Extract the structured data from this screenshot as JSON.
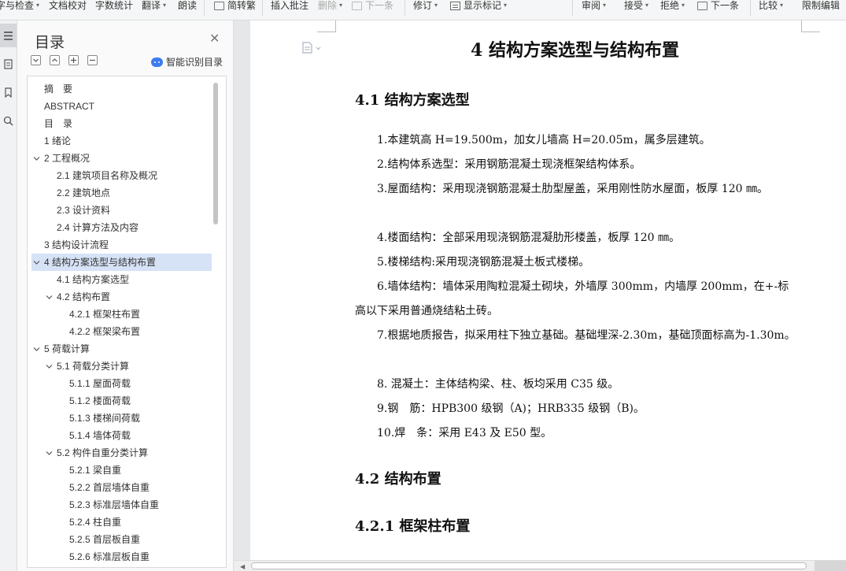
{
  "toolbar": {
    "items": [
      {
        "label": "字与检查",
        "caret": true
      },
      {
        "label": "文档校对",
        "caret": false
      },
      {
        "label": "字数统计",
        "caret": false
      },
      {
        "label": "翻译",
        "caret": true
      },
      {
        "label": "朗读",
        "caret": false
      },
      {
        "label": "简转繁",
        "caret": false
      },
      {
        "label": "插入批注",
        "caret": false
      },
      {
        "label": "删除",
        "caret": true
      },
      {
        "label": "下一条",
        "caret": false
      },
      {
        "label": "修订",
        "caret": true
      },
      {
        "label": "显示标记",
        "caret": true
      },
      {
        "label": "审阅",
        "caret": true
      },
      {
        "label": "接受",
        "caret": true
      },
      {
        "label": "拒绝",
        "caret": true
      },
      {
        "label": "下一条",
        "caret": false
      },
      {
        "label": "比较",
        "caret": true
      },
      {
        "label": "限制编辑",
        "caret": false
      }
    ],
    "caret_glyph": "▾"
  },
  "toc": {
    "title": "目录",
    "close_glyph": "✕",
    "smart_label": "智能识别目录",
    "expanded_glyph": "⌄",
    "items": [
      {
        "label": "摘　要",
        "level": 1,
        "caret": false,
        "selected": false
      },
      {
        "label": "ABSTRACT",
        "level": 1,
        "caret": false,
        "selected": false
      },
      {
        "label": "目　录",
        "level": 1,
        "caret": false,
        "selected": false
      },
      {
        "label": "1 绪论",
        "level": 1,
        "caret": false,
        "selected": false
      },
      {
        "label": "2 工程概况",
        "level": 1,
        "caret": true,
        "selected": false
      },
      {
        "label": "2.1 建筑项目名称及概况",
        "level": 2,
        "caret": false,
        "selected": false
      },
      {
        "label": "2.2 建筑地点",
        "level": 2,
        "caret": false,
        "selected": false
      },
      {
        "label": "2.3  设计资料",
        "level": 2,
        "caret": false,
        "selected": false
      },
      {
        "label": "2.4 计算方法及内容",
        "level": 2,
        "caret": false,
        "selected": false
      },
      {
        "label": "3 结构设计流程",
        "level": 1,
        "caret": false,
        "selected": false
      },
      {
        "label": "4 结构方案选型与结构布置",
        "level": 1,
        "caret": true,
        "selected": true
      },
      {
        "label": "4.1 结构方案选型",
        "level": 2,
        "caret": false,
        "selected": false
      },
      {
        "label": "4.2 结构布置",
        "level": 2,
        "caret": true,
        "selected": false
      },
      {
        "label": "4.2.1 框架柱布置",
        "level": 3,
        "caret": false,
        "selected": false
      },
      {
        "label": "4.2.2 框架梁布置",
        "level": 3,
        "caret": false,
        "selected": false
      },
      {
        "label": "5 荷载计算",
        "level": 1,
        "caret": true,
        "selected": false
      },
      {
        "label": "5.1 荷载分类计算",
        "level": 2,
        "caret": true,
        "selected": false
      },
      {
        "label": "5.1.1 屋面荷载",
        "level": 3,
        "caret": false,
        "selected": false
      },
      {
        "label": "5.1.2 楼面荷载",
        "level": 3,
        "caret": false,
        "selected": false
      },
      {
        "label": "5.1.3 楼梯间荷载",
        "level": 3,
        "caret": false,
        "selected": false
      },
      {
        "label": "5.1.4 墙体荷载",
        "level": 3,
        "caret": false,
        "selected": false
      },
      {
        "label": "5.2 构件自重分类计算",
        "level": 2,
        "caret": true,
        "selected": false
      },
      {
        "label": "5.2.1 梁自重",
        "level": 3,
        "caret": false,
        "selected": false
      },
      {
        "label": "5.2.2 首层墙体自重",
        "level": 3,
        "caret": false,
        "selected": false
      },
      {
        "label": "5.2.3 标准层墙体自重",
        "level": 3,
        "caret": false,
        "selected": false
      },
      {
        "label": "5.2.4 柱自重",
        "level": 3,
        "caret": false,
        "selected": false
      },
      {
        "label": "5.2.5 首层板自重",
        "level": 3,
        "caret": false,
        "selected": false
      },
      {
        "label": "5.2.6 标准层板自重",
        "level": 3,
        "caret": false,
        "selected": false
      }
    ]
  },
  "document": {
    "title": "4 结构方案选型与结构布置",
    "section_1": "4.1 结构方案选型",
    "paragraphs": [
      "1.本建筑高 H=19.500m，加女儿墙高 H=20.05m，属多层建筑。",
      "2.结构体系选型：采用钢筋混凝土现浇框架结构体系。",
      "3.屋面结构：采用现浇钢筋混凝土肋型屋盖，采用刚性防水屋面，板厚 120 ㎜。",
      "4.楼面结构：全部采用现浇钢筋混凝肋形楼盖，板厚 120 ㎜。",
      "5.楼梯结构:采用现浇钢筋混凝土板式楼梯。",
      "6.墙体结构：墙体采用陶粒混凝土砌块，外墙厚 300mm，内墙厚 200mm，在+-标高以下采用普通烧结粘土砖。",
      "7.根据地质报告，拟采用柱下独立基础。基础埋深-2.30m，基础顶面标高为-1.30m。",
      "8. 混凝土：主体结构梁、柱、板均采用 C35 级。",
      "9.钢　筋：HPB300 级钢（A)；HRB335 级钢（B)。",
      "10.焊　条：采用 E43 及 E50 型。"
    ],
    "section_2": "4.2 结构布置",
    "section_2_1": "4.2.1 框架柱布置"
  }
}
